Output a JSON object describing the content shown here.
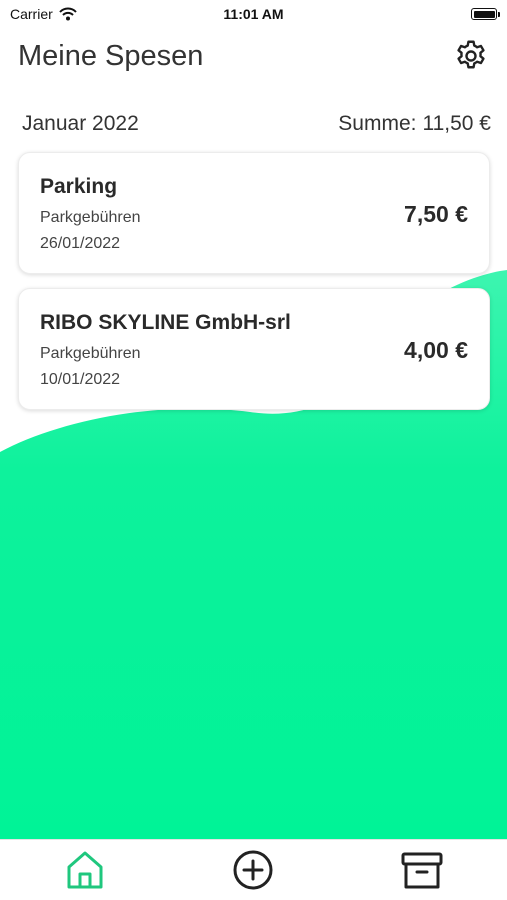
{
  "status_bar": {
    "carrier": "Carrier",
    "time": "11:01 AM"
  },
  "header": {
    "title": "Meine Spesen"
  },
  "summary": {
    "month": "Januar 2022",
    "sum_label": "Summe:",
    "sum_value": "11,50 €"
  },
  "expenses": [
    {
      "title": "Parking",
      "category": "Parkgebühren",
      "date": "26/01/2022",
      "amount": "7,50 €"
    },
    {
      "title": "RIBO SKYLINE GmbH-srl",
      "category": "Parkgebühren",
      "date": "10/01/2022",
      "amount": "4,00 €"
    }
  ],
  "tabbar": {
    "tabs": [
      {
        "icon": "home-icon",
        "active": true
      },
      {
        "icon": "add-circle-icon",
        "active": false
      },
      {
        "icon": "archive-icon",
        "active": false
      }
    ]
  },
  "colors": {
    "accent": "#00F29A",
    "accent_light": "#3DF5B0",
    "active_tab": "#1FC77E",
    "text": "#2A2A2A"
  }
}
